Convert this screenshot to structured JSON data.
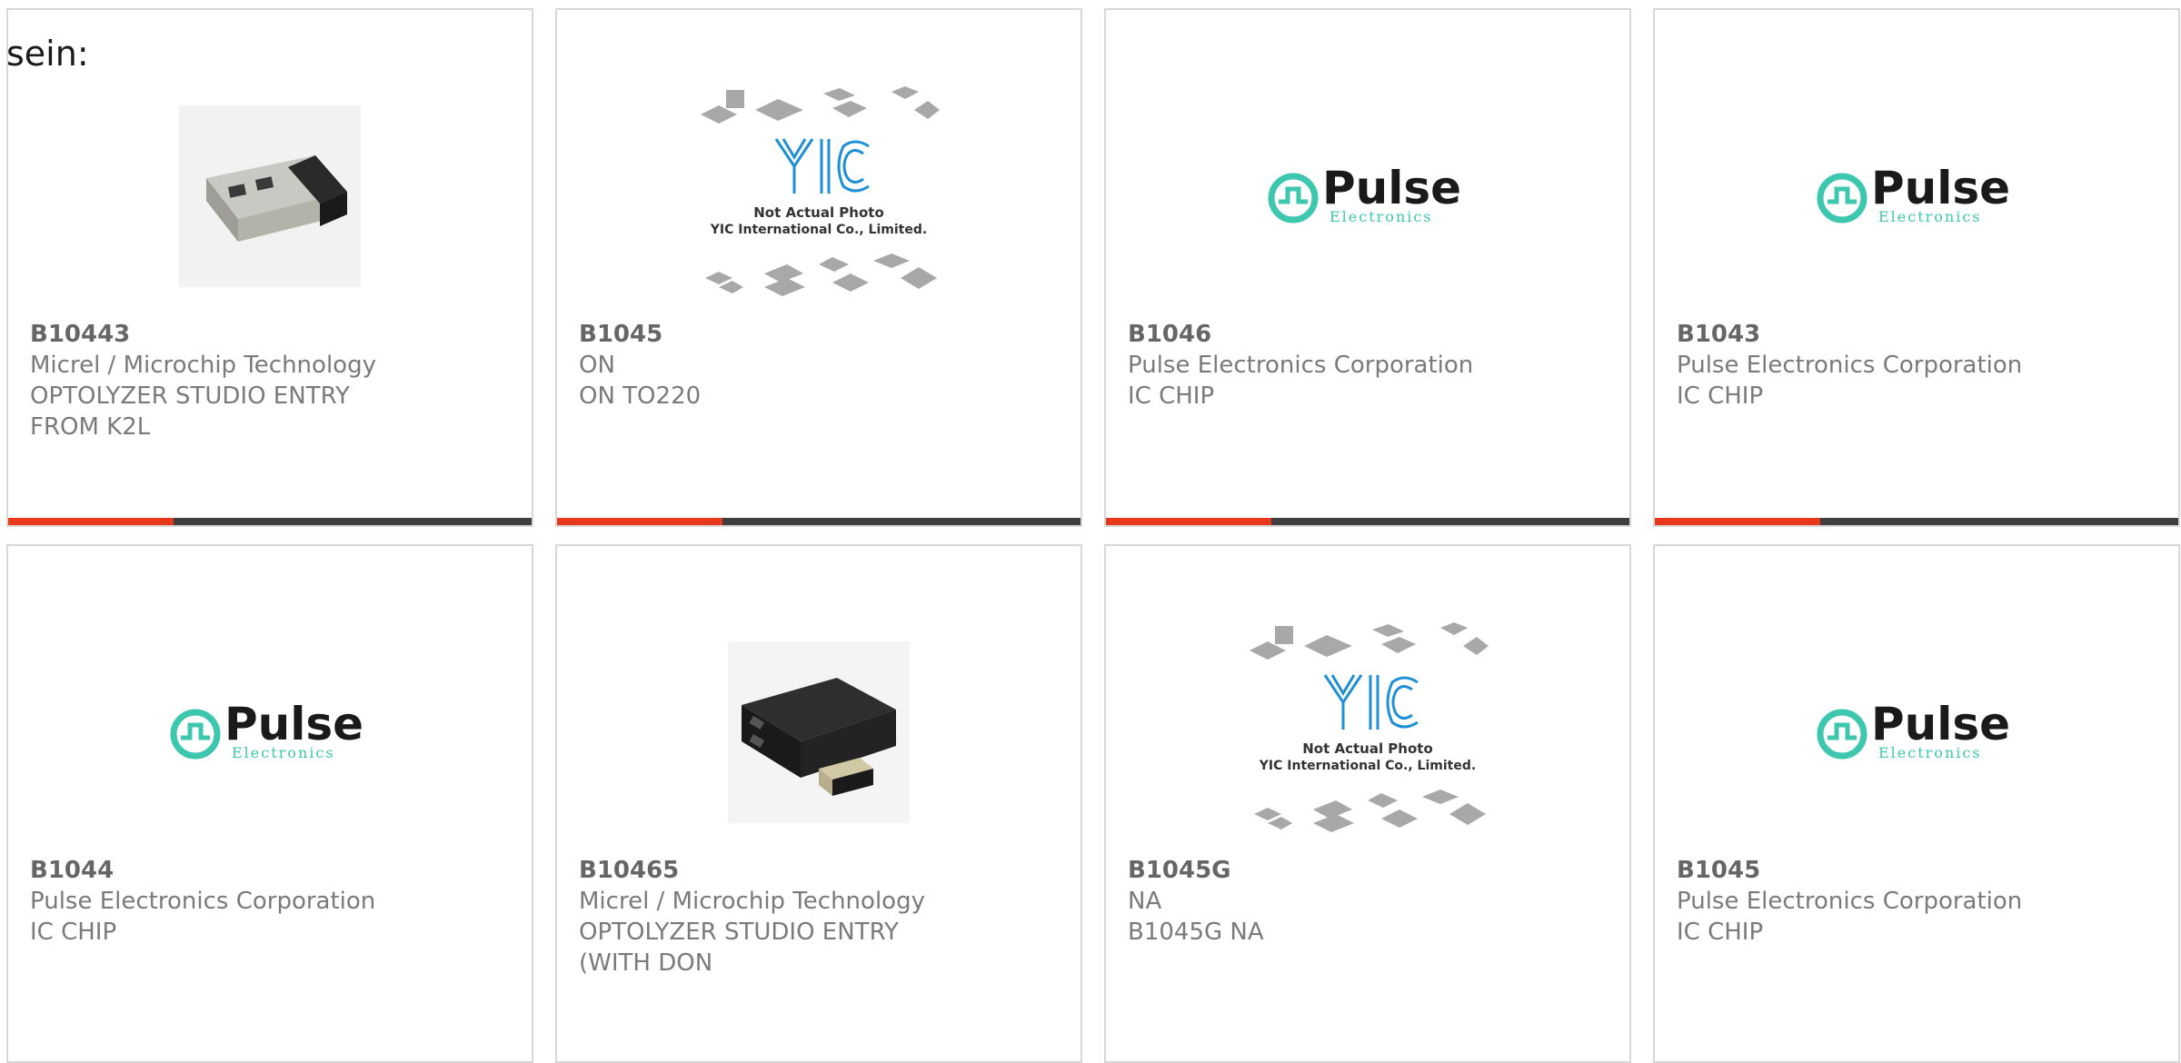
{
  "intro_text": "sein:",
  "colors": {
    "accent_bar": "#e8371b",
    "dark_bar": "#3e3e3e",
    "pulse_teal": "#3cc7ae",
    "card_border": "#d7d7d7"
  },
  "logos": {
    "pulse_word": "Pulse",
    "pulse_sub": "Electronics",
    "yic_mark": "YIC",
    "yic_line1": "Not Actual Photo",
    "yic_line2": "YIC International Co., Limited."
  },
  "products": [
    {
      "part": "B10443",
      "maker": "Micrel / Microchip Technology",
      "desc": "OPTOLYZER STUDIO ENTRY\nFROM K2L",
      "image": "usb-dongle-photo"
    },
    {
      "part": "B1045",
      "maker": "ON",
      "desc": "ON TO220",
      "image": "yic-placeholder"
    },
    {
      "part": "B1046",
      "maker": "Pulse Electronics Corporation",
      "desc": "IC CHIP",
      "image": "pulse-logo"
    },
    {
      "part": "B1043",
      "maker": "Pulse Electronics Corporation",
      "desc": "IC CHIP",
      "image": "pulse-logo"
    },
    {
      "part": "B1044",
      "maker": "Pulse Electronics Corporation",
      "desc": "IC CHIP",
      "image": "pulse-logo"
    },
    {
      "part": "B10465",
      "maker": "Micrel / Microchip Technology",
      "desc": "OPTOLYZER STUDIO ENTRY\n(WITH DON",
      "image": "optolyzer-device-photo"
    },
    {
      "part": "B1045G",
      "maker": "NA",
      "desc": "B1045G NA",
      "image": "yic-placeholder"
    },
    {
      "part": "B1045",
      "maker": "Pulse Electronics Corporation",
      "desc": "IC CHIP",
      "image": "pulse-logo"
    }
  ]
}
